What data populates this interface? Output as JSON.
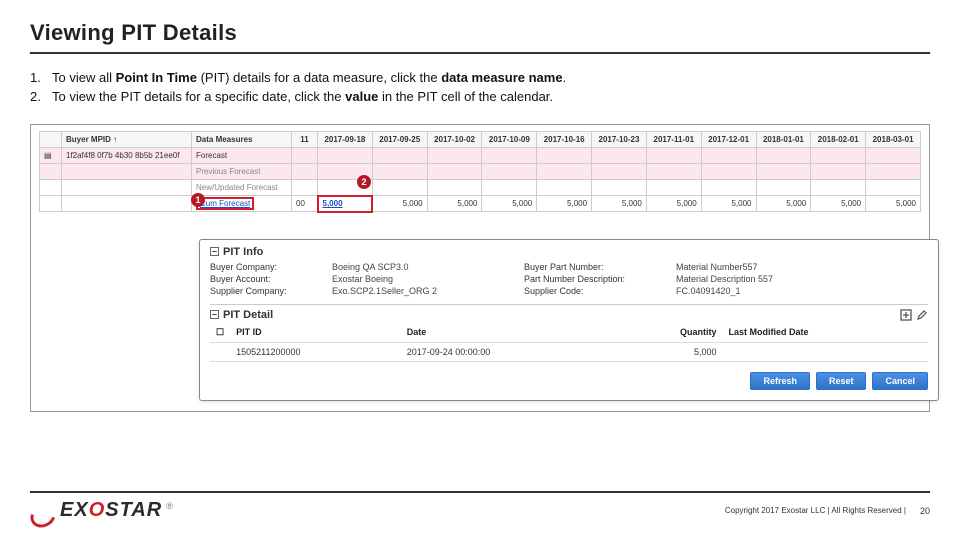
{
  "title": "Viewing PIT Details",
  "instructions": {
    "num1": "1.",
    "line1_a": "To view all ",
    "line1_b": "Point In Time",
    "line1_c": " (PIT) details for a data measure, click the ",
    "line1_d": "data measure name",
    "line1_e": ".",
    "num2": "2.",
    "line2_a": "To view the PIT details for a specific date, click the ",
    "line2_b": "value",
    "line2_c": " in the PIT cell of the calendar."
  },
  "markers": {
    "m1": "1",
    "m2": "2"
  },
  "grid": {
    "headers": {
      "buyer_mpid": "Buyer MPID ↑",
      "data_measures": "Data Measures",
      "colA": "11",
      "d1": "2017-09-18",
      "d2": "2017-09-25",
      "d3": "2017-10-02",
      "d4": "2017-10-09",
      "d5": "2017-10-16",
      "d6": "2017-10-23",
      "d7": "2017-11-01",
      "d8": "2017-12-01",
      "d9": "2018-01-01",
      "d10": "2018-02-01",
      "d11": "2018-03-01"
    },
    "mpid": "1f2af4f8 0f7b 4b30 8b5b 21ee0f",
    "measures": {
      "forecast": "Forecast",
      "prev": "Previous Forecast",
      "newupd": "New/Updated Forecast",
      "cum": "Cum Forecast"
    },
    "cum_row": {
      "c0": "00",
      "v1": "5,000",
      "v2": "5,000",
      "v3": "5,000",
      "v4": "5,000",
      "v5": "5,000",
      "v6": "5,000",
      "v7": "5,000",
      "v8": "5,000",
      "v9": "5,000",
      "v10": "5,000",
      "v11": "5,000"
    }
  },
  "pit": {
    "info_head": "PIT Info",
    "detail_head": "PIT Detail",
    "labels": {
      "buyer_company": "Buyer Company:",
      "buyer_account": "Buyer Account:",
      "supplier_company": "Supplier Company:",
      "buyer_part": "Buyer Part Number:",
      "part_desc": "Part Number Description:",
      "supplier_code": "Supplier Code:"
    },
    "values": {
      "buyer_company": "Boeing QA SCP3.0",
      "buyer_account": "Exostar Boeing",
      "supplier_company": "Exo.SCP2.1Seller_ORG 2",
      "buyer_part": "Material Number557",
      "part_desc": "Material Description 557",
      "supplier_code": "FC.04091420_1"
    },
    "table": {
      "h_pit": "PIT ID",
      "h_date": "Date",
      "h_qty": "Quantity",
      "h_mod": "Last Modified Date",
      "pit_id": "1505211200000",
      "date": "2017-09-24 00:00:00",
      "qty": "5,000"
    },
    "buttons": {
      "refresh": "Refresh",
      "reset": "Reset",
      "cancel": "Cancel"
    }
  },
  "footer": {
    "logo_prefix": "EX",
    "logo_o": "O",
    "logo_suffix": "STAR",
    "reg": "®",
    "copyright": "Copyright 2017 Exostar LLC | All Rights Reserved |",
    "page": "20"
  }
}
